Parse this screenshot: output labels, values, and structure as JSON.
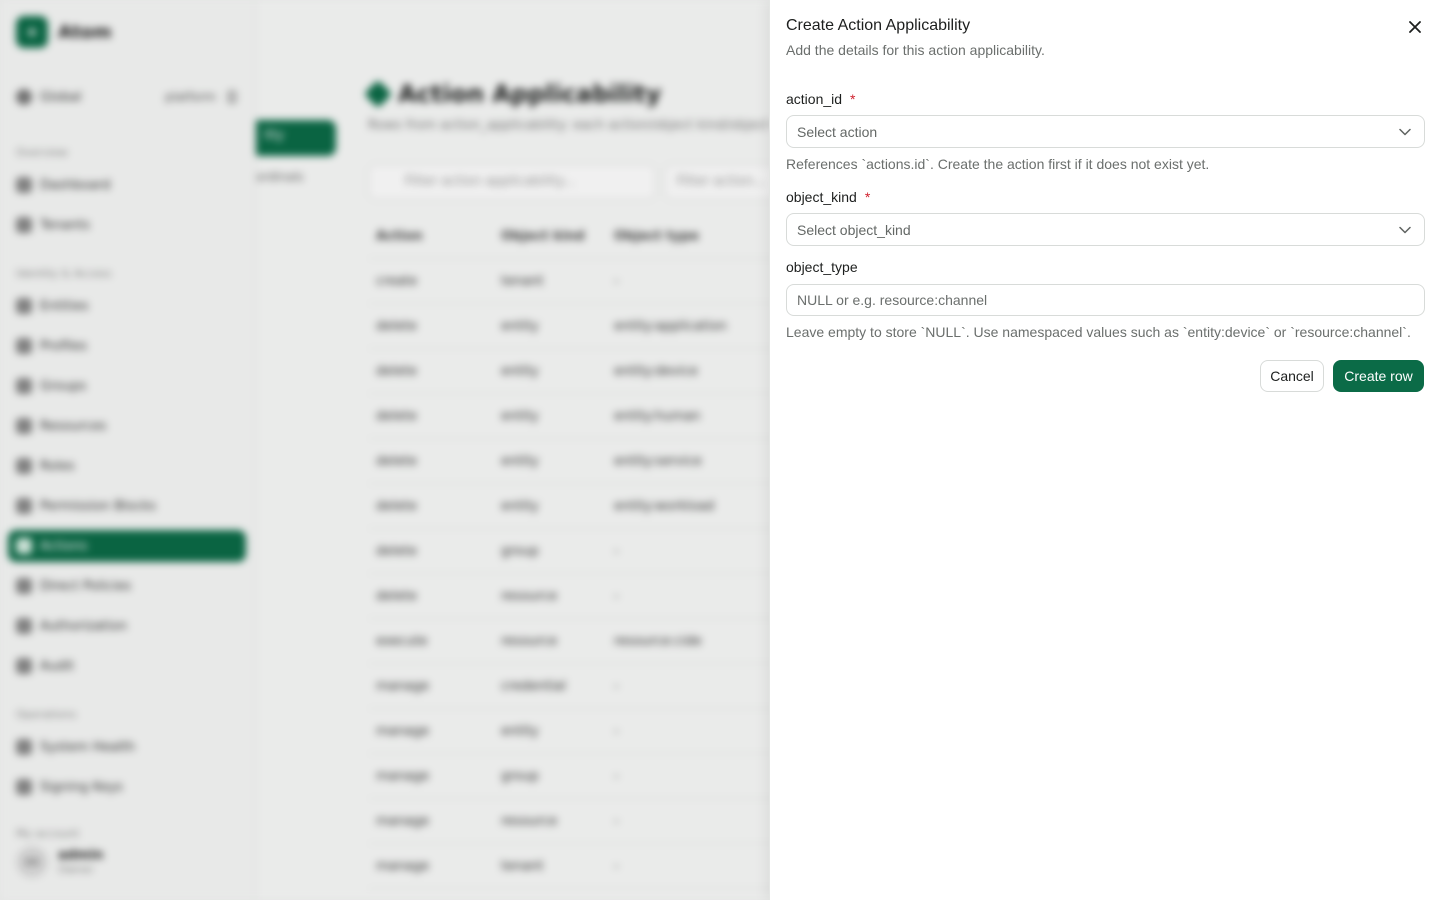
{
  "app": {
    "brand": "Atom",
    "scope": {
      "label": "Global",
      "tenant": "platform"
    },
    "sections": [
      "Overview",
      "Identity & Access",
      "Operations",
      "My account"
    ],
    "nav": {
      "dashboard": "Dashboard",
      "tenants": "Tenants",
      "entities": "Entities",
      "profiles": "Profiles",
      "groups": "Groups",
      "resources": "Resources",
      "roles": "Roles",
      "permission_blocks": "Permission Blocks",
      "actions": "Actions",
      "direct_policies": "Direct Policies",
      "authorization": "Authorization",
      "audit": "Audit",
      "system_health": "System Health",
      "signing_keys": "Signing Keys"
    },
    "user": {
      "initials": "AA",
      "name": "admin",
      "role": "Owner"
    },
    "side_button": "lity",
    "side_text": "ordinals",
    "page_title": "Action Applicability",
    "page_subtitle": "Rows from action_applicability: each action/object kind/object type",
    "filter_placeholder": "Filter action applicability...",
    "filter_action_placeholder": "Filter action...",
    "table": {
      "headers": [
        "Action",
        "Object kind",
        "Object type"
      ],
      "rows": [
        [
          "create",
          "tenant",
          "-"
        ],
        [
          "delete",
          "entity",
          "entity:application"
        ],
        [
          "delete",
          "entity",
          "entity:device"
        ],
        [
          "delete",
          "entity",
          "entity:human"
        ],
        [
          "delete",
          "entity",
          "entity:service"
        ],
        [
          "delete",
          "entity",
          "entity:workload"
        ],
        [
          "delete",
          "group",
          "-"
        ],
        [
          "delete",
          "resource",
          "-"
        ],
        [
          "execute",
          "resource",
          "resource:cide"
        ],
        [
          "manage",
          "credential",
          "-"
        ],
        [
          "manage",
          "entity",
          "-"
        ],
        [
          "manage",
          "group",
          "-"
        ],
        [
          "manage",
          "resource",
          "-"
        ],
        [
          "manage",
          "tenant",
          "-"
        ]
      ]
    }
  },
  "drawer": {
    "title": "Create Action Applicability",
    "description": "Add the details for this action applicability.",
    "fields": {
      "action_id": {
        "label": "action_id",
        "required_mark": "*",
        "value": "Select action",
        "help": "References `actions.id`. Create the action first if it does not exist yet."
      },
      "object_kind": {
        "label": "object_kind",
        "required_mark": "*",
        "value": "Select object_kind"
      },
      "object_type": {
        "label": "object_type",
        "placeholder": "NULL or e.g. resource:channel",
        "help": "Leave empty to store `NULL`. Use namespaced values such as `entity:device` or `resource:channel`."
      }
    },
    "cancel_label": "Cancel",
    "submit_label": "Create row"
  },
  "colors": {
    "accent": "#0b6b47",
    "required": "#d0212e"
  }
}
